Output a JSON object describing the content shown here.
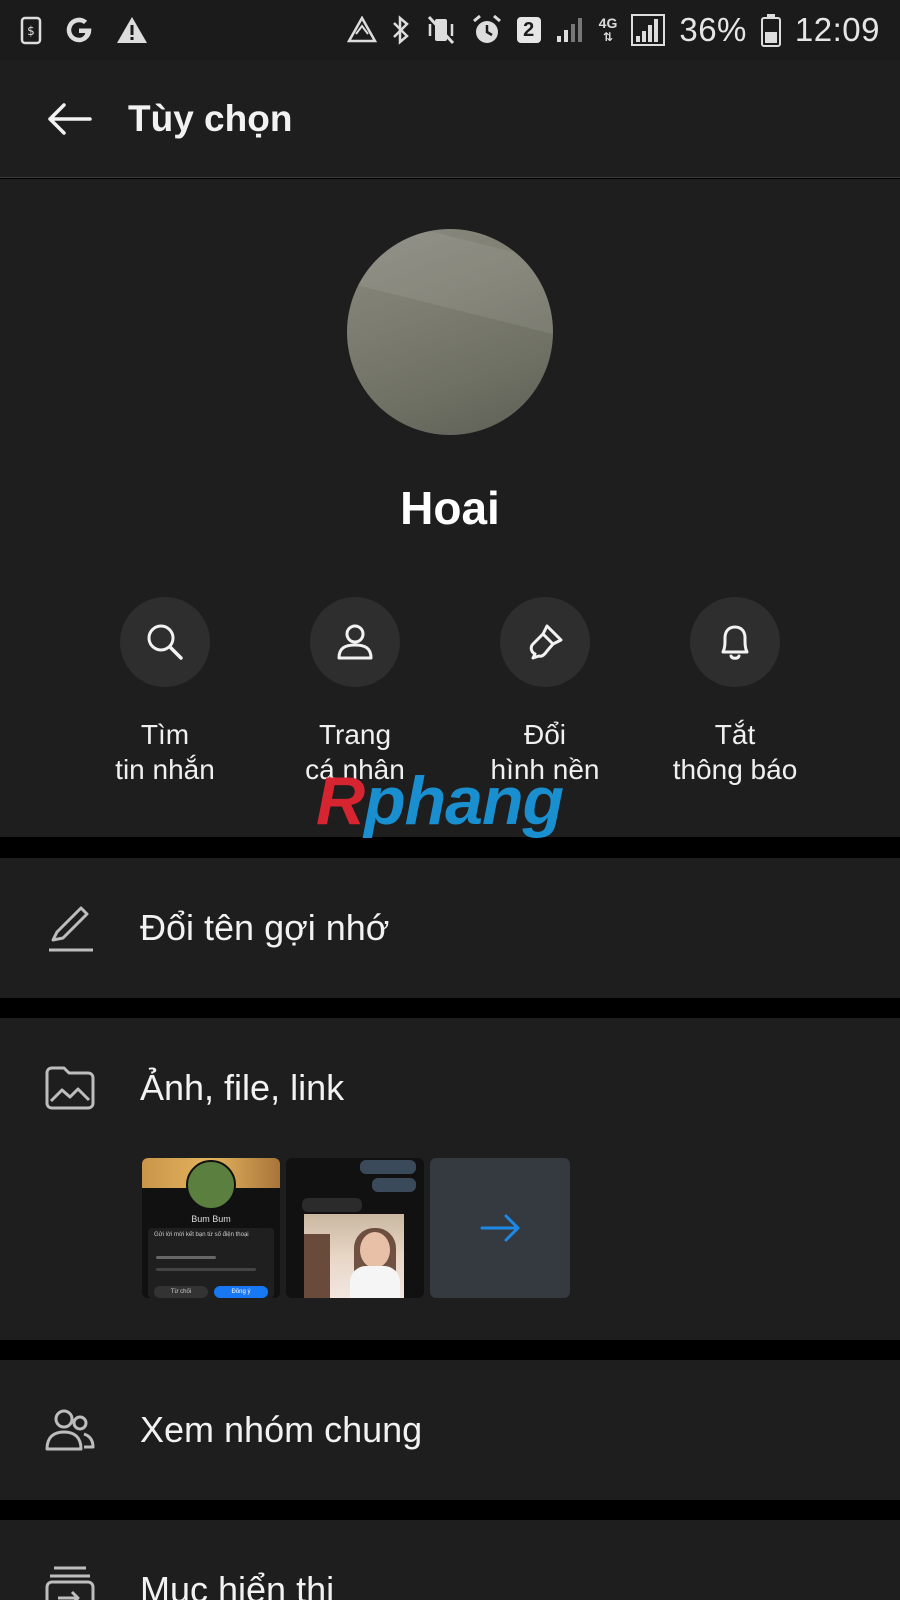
{
  "status_bar": {
    "badge": "2",
    "network": "4G",
    "battery": "36%",
    "time": "12:09"
  },
  "header": {
    "title": "Tùy chọn"
  },
  "profile": {
    "name": "Hoai"
  },
  "actions": [
    {
      "line1": "Tìm",
      "line2": "tin nhắn",
      "icon": "search-icon"
    },
    {
      "line1": "Trang",
      "line2": "cá nhân",
      "icon": "person-icon"
    },
    {
      "line1": "Đổi",
      "line2": "hình nền",
      "icon": "paint-brush-icon"
    },
    {
      "line1": "Tắt",
      "line2": "thông báo",
      "icon": "bell-icon"
    }
  ],
  "watermark": {
    "part1": "R",
    "part2": "phang"
  },
  "menu": {
    "rename": "Đổi tên gợi nhớ",
    "media": "Ảnh, file, link",
    "groups": "Xem nhóm chung",
    "display": "Mục hiển thị"
  },
  "thumbnails": {
    "t1_name": "Bum Bum",
    "t1_text": "Gửi lời mời kết bạn từ số điện thoại",
    "t1_decline": "Từ chối",
    "t1_accept": "Đồng ý"
  },
  "colors": {
    "background": "#1e1e1e",
    "divider": "#000000",
    "accent": "#1e88e5"
  }
}
